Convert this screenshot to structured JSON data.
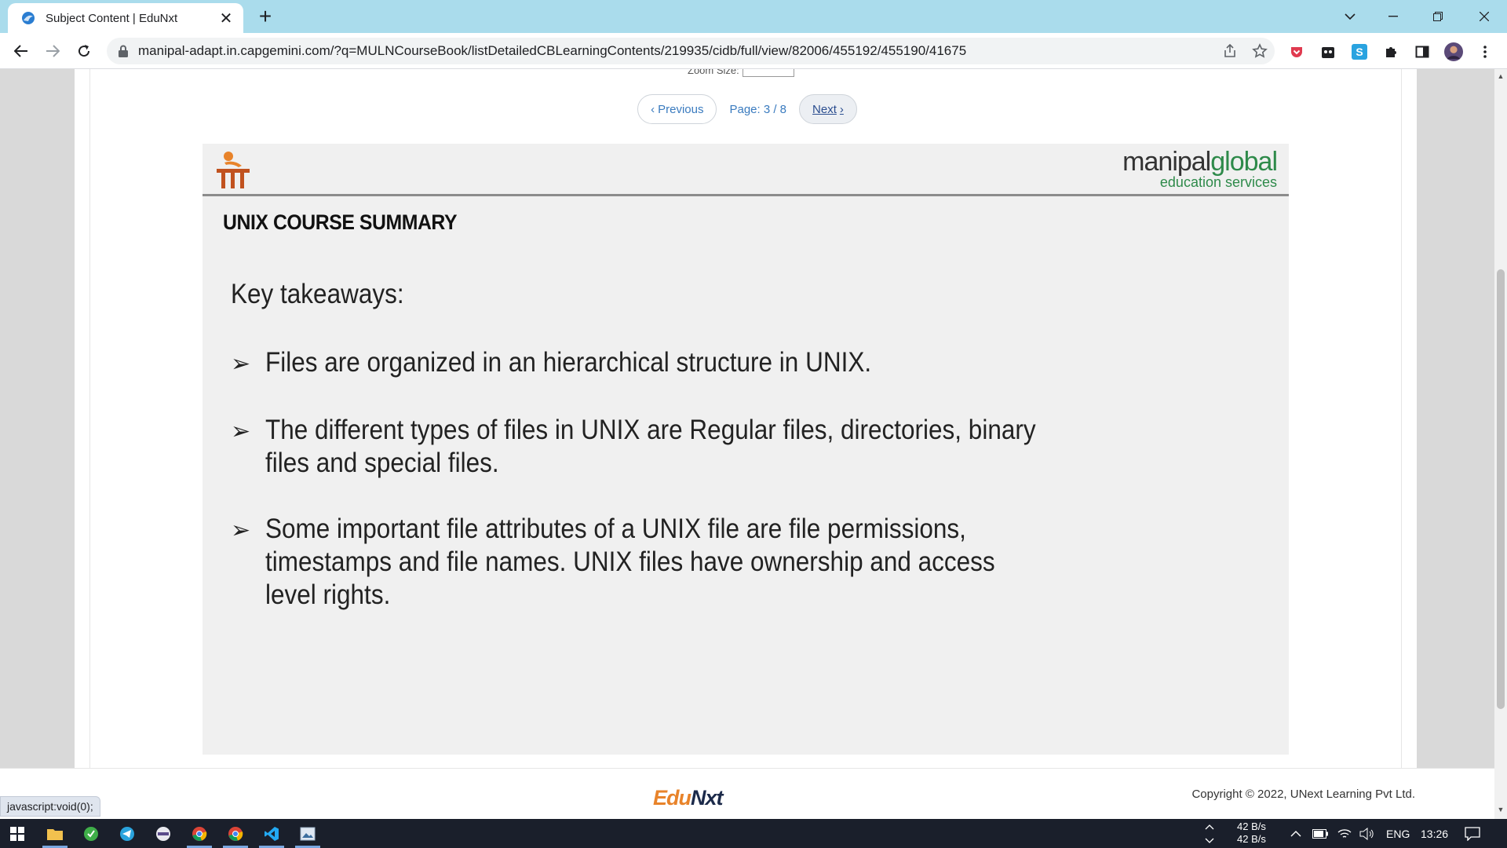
{
  "browser": {
    "tab_title": "Subject Content | EduNxt",
    "url": "manipal-adapt.in.capgemini.com/?q=MULNCourseBook/listDetailedCBLearningContents/219935/cidb/full/view/82006/455192/455190/41675"
  },
  "viewer": {
    "zoom_label": "Zoom Size:",
    "previous_label": "Previous",
    "page_info": "Page: 3 / 8",
    "next_label": "Next"
  },
  "slide": {
    "brand_main_1": "manipal",
    "brand_main_2": "global",
    "brand_sub": "education services",
    "title": "UNIX COURSE SUMMARY",
    "intro": "Key takeaways:",
    "bullets": [
      "Files are organized in an hierarchical structure in UNIX.",
      "The different types of files in UNIX are Regular files, directories, binary files and special files.",
      "Some important file attributes of a UNIX file are file permissions, timestamps and file names. UNIX files have ownership and access level rights."
    ]
  },
  "footer": {
    "logo_part1": "Edu",
    "logo_part2": "Nxt",
    "copyright": "Copyright © 2022, UNext Learning Pvt Ltd.",
    "status_text": "javascript:void(0);"
  },
  "taskbar": {
    "net_up": "42 B/s",
    "net_down": "42 B/s",
    "language": "ENG",
    "time": "13:26"
  },
  "colors": {
    "tabstrip": "#aadcec",
    "brand_green": "#2e8a4a",
    "edunxt_orange": "#e8832a"
  }
}
